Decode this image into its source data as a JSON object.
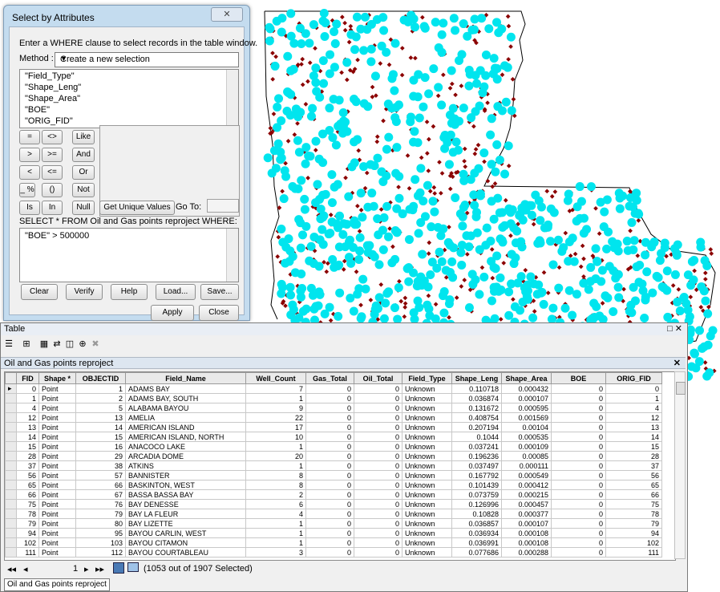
{
  "dialog": {
    "title": "Select by Attributes",
    "close_glyph": "✕",
    "instruction": "Enter a WHERE clause to select records in the table window.",
    "method_label": "Method :",
    "method_value": "Create a new selection",
    "fields": [
      "\"Field_Type\"",
      "\"Shape_Leng\"",
      "\"Shape_Area\"",
      "\"BOE\"",
      "\"ORIG_FID\""
    ],
    "operators": {
      "eq": "=",
      "ne": "<>",
      "like": "Like",
      "gt": ">",
      "ge": ">=",
      "and": "And",
      "lt": "<",
      "le": "<=",
      "or": "Or",
      "underscore_pct": "_ %",
      "parens": "()",
      "not": "Not",
      "is": "Is",
      "in": "In",
      "null": "Null"
    },
    "get_unique_values": "Get Unique Values",
    "go_to": "Go To:",
    "select_statement": "SELECT * FROM Oil and Gas points reproject WHERE:",
    "expression": "\"BOE\" > 500000",
    "buttons": {
      "clear": "Clear",
      "verify": "Verify",
      "help": "Help",
      "load": "Load...",
      "save": "Save...",
      "apply": "Apply",
      "close": "Close"
    }
  },
  "table_window": {
    "title": "Table",
    "window_controls": "□ ✕",
    "tab_title": "Oil and Gas points reproject",
    "tab_close": "✕",
    "columns": [
      "FID",
      "Shape *",
      "OBJECTID",
      "Field_Name",
      "Well_Count",
      "Gas_Total",
      "Oil_Total",
      "Field_Type",
      "Shape_Leng",
      "Shape_Area",
      "BOE",
      "ORIG_FID"
    ],
    "rows": [
      [
        "0",
        "Point",
        "1",
        "ADAMS BAY",
        "7",
        "0",
        "0",
        "Unknown",
        "0.110718",
        "0.000432",
        "0",
        "0"
      ],
      [
        "1",
        "Point",
        "2",
        "ADAMS BAY, SOUTH",
        "1",
        "0",
        "0",
        "Unknown",
        "0.036874",
        "0.000107",
        "0",
        "1"
      ],
      [
        "4",
        "Point",
        "5",
        "ALABAMA BAYOU",
        "9",
        "0",
        "0",
        "Unknown",
        "0.131672",
        "0.000595",
        "0",
        "4"
      ],
      [
        "12",
        "Point",
        "13",
        "AMELIA",
        "22",
        "0",
        "0",
        "Unknown",
        "0.408754",
        "0.001569",
        "0",
        "12"
      ],
      [
        "13",
        "Point",
        "14",
        "AMERICAN ISLAND",
        "17",
        "0",
        "0",
        "Unknown",
        "0.207194",
        "0.00104",
        "0",
        "13"
      ],
      [
        "14",
        "Point",
        "15",
        "AMERICAN ISLAND, NORTH",
        "10",
        "0",
        "0",
        "Unknown",
        "0.1044",
        "0.000535",
        "0",
        "14"
      ],
      [
        "15",
        "Point",
        "16",
        "ANACOCO LAKE",
        "1",
        "0",
        "0",
        "Unknown",
        "0.037241",
        "0.000109",
        "0",
        "15"
      ],
      [
        "28",
        "Point",
        "29",
        "ARCADIA DOME",
        "20",
        "0",
        "0",
        "Unknown",
        "0.196236",
        "0.00085",
        "0",
        "28"
      ],
      [
        "37",
        "Point",
        "38",
        "ATKINS",
        "1",
        "0",
        "0",
        "Unknown",
        "0.037497",
        "0.000111",
        "0",
        "37"
      ],
      [
        "56",
        "Point",
        "57",
        "BANNISTER",
        "8",
        "0",
        "0",
        "Unknown",
        "0.167792",
        "0.000549",
        "0",
        "56"
      ],
      [
        "65",
        "Point",
        "66",
        "BASKINTON, WEST",
        "8",
        "0",
        "0",
        "Unknown",
        "0.101439",
        "0.000412",
        "0",
        "65"
      ],
      [
        "66",
        "Point",
        "67",
        "BASSA BASSA BAY",
        "2",
        "0",
        "0",
        "Unknown",
        "0.073759",
        "0.000215",
        "0",
        "66"
      ],
      [
        "75",
        "Point",
        "76",
        "BAY DENESSE",
        "6",
        "0",
        "0",
        "Unknown",
        "0.126996",
        "0.000457",
        "0",
        "75"
      ],
      [
        "78",
        "Point",
        "79",
        "BAY LA FLEUR",
        "4",
        "0",
        "0",
        "Unknown",
        "0.10828",
        "0.000377",
        "0",
        "78"
      ],
      [
        "79",
        "Point",
        "80",
        "BAY LIZETTE",
        "1",
        "0",
        "0",
        "Unknown",
        "0.036857",
        "0.000107",
        "0",
        "79"
      ],
      [
        "94",
        "Point",
        "95",
        "BAYOU CARLIN, WEST",
        "1",
        "0",
        "0",
        "Unknown",
        "0.036934",
        "0.000108",
        "0",
        "94"
      ],
      [
        "102",
        "Point",
        "103",
        "BAYOU CITAMON",
        "1",
        "0",
        "0",
        "Unknown",
        "0.036991",
        "0.000108",
        "0",
        "102"
      ],
      [
        "111",
        "Point",
        "112",
        "BAYOU COURTABLEAU",
        "3",
        "0",
        "0",
        "Unknown",
        "0.077686",
        "0.000288",
        "0",
        "111"
      ]
    ],
    "nav": {
      "first": "◂◂",
      "prev": "◂",
      "record": "1",
      "next": "▸",
      "last": "▸▸",
      "status": "(1053 out of 1907 Selected)"
    },
    "bottom_tab": "Oil and Gas points reproject"
  },
  "colors": {
    "selected_points": "#00e5ee",
    "points": "#8b0000",
    "dialog_frame": "#c4dcef"
  }
}
